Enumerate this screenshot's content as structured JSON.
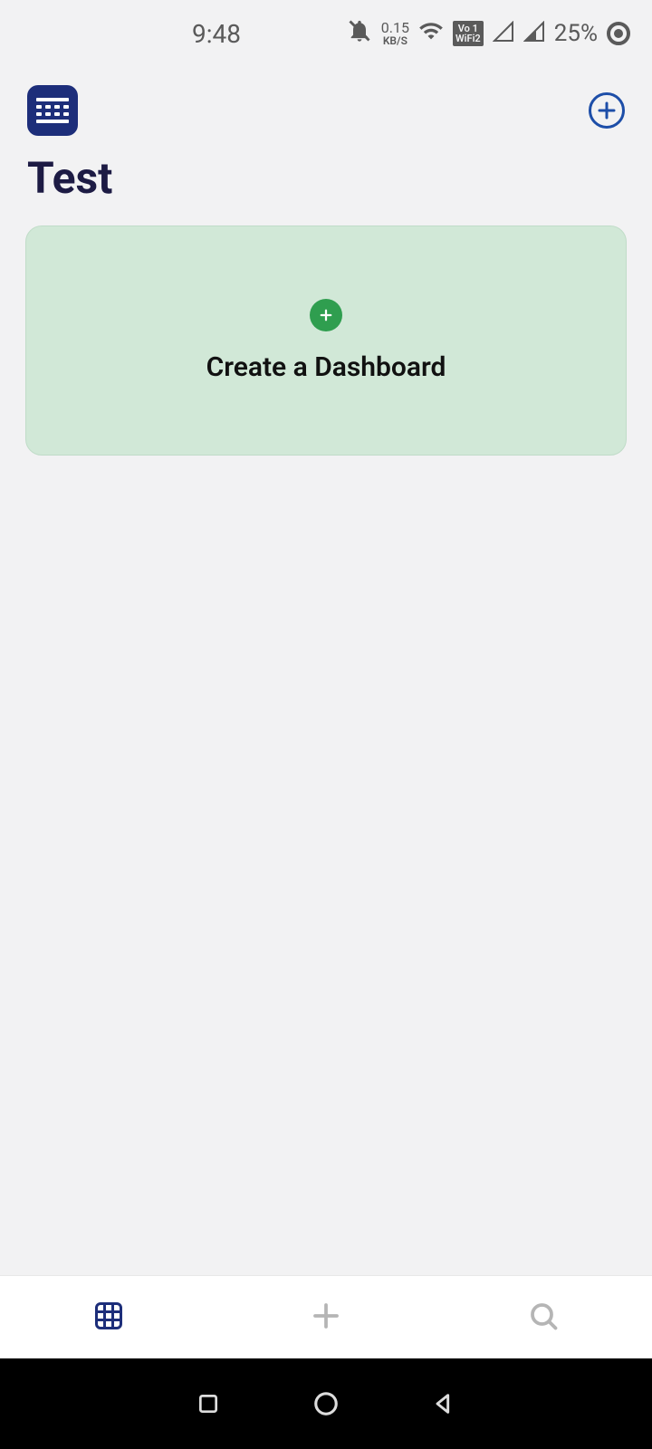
{
  "status_bar": {
    "time": "9:48",
    "data_rate_value": "0.15",
    "data_rate_unit": "KB/S",
    "vowifi_top": "Vo 1",
    "vowifi_bottom": "WiFi2",
    "battery": "25%"
  },
  "header": {
    "logo_name": "app-logo"
  },
  "page": {
    "title": "Test"
  },
  "card": {
    "label": "Create a Dashboard"
  },
  "colors": {
    "primary_dark": "#1d2e7a",
    "accent_blue": "#1d4ea8",
    "card_bg": "#d1e8d7",
    "card_plus": "#2f9e4f"
  }
}
